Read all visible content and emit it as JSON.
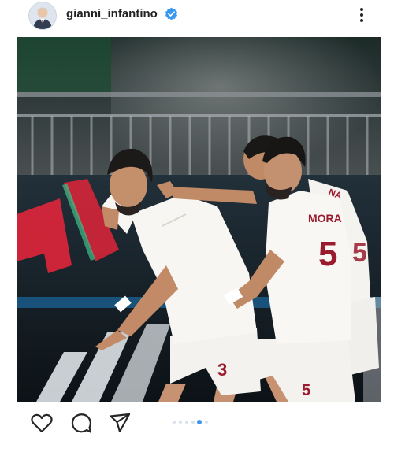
{
  "post": {
    "username": "gianni_infantino",
    "verified": true,
    "more_icon": "more-vertical-icon",
    "photo": {
      "description_icons": [
        "players-celebrating"
      ],
      "jersey_numbers": [
        "3",
        "5",
        "5"
      ],
      "jersey_names": [
        "MORA",
        "NA"
      ]
    },
    "actions": {
      "like_icon": "heart-icon",
      "comment_icon": "comment-icon",
      "share_icon": "send-icon"
    },
    "carousel": {
      "count": 6,
      "active_index": 4
    }
  },
  "colors": {
    "verified_blue": "#3897f0",
    "carousel_active": "#3897f0",
    "carousel_inactive": "#d9e1ea"
  }
}
